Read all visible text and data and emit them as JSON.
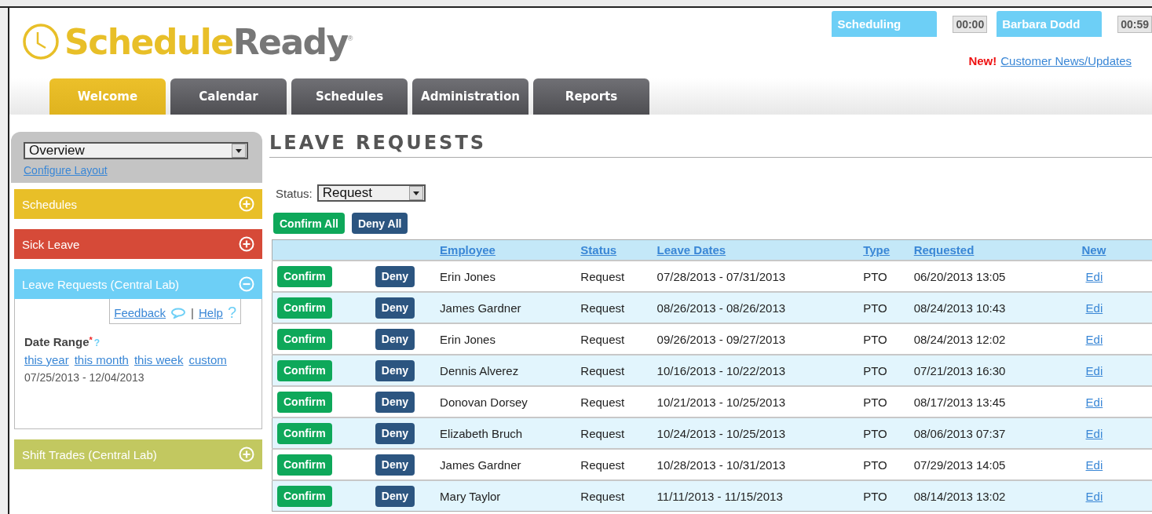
{
  "logo": {
    "word_1": "Schedule",
    "word_2": "Ready",
    "mark": "®"
  },
  "session": [
    {
      "label": "Scheduling",
      "timer": "00:00"
    },
    {
      "label": "Barbara Dodd",
      "timer": "00:59"
    }
  ],
  "news": {
    "badge": "New!",
    "link": "Customer News/Updates"
  },
  "tabs": [
    {
      "label": "Welcome",
      "selected": true
    },
    {
      "label": "Calendar",
      "selected": false
    },
    {
      "label": "Schedules",
      "selected": false
    },
    {
      "label": "Administration",
      "selected": false
    },
    {
      "label": "Reports",
      "selected": false
    }
  ],
  "sidebar": {
    "layout_select": "Overview",
    "configure_link": "Configure Layout",
    "panels": [
      {
        "title": "Schedules",
        "color": "#e8bf28",
        "expanded": false
      },
      {
        "title": "Sick Leave",
        "color": "#d64a38",
        "expanded": false
      },
      {
        "title": "Leave Requests (Central Lab)",
        "color": "#6dcff6",
        "expanded": true,
        "feedback": "Feedback",
        "help": "Help",
        "separator": "|",
        "date_range_label": "Date Range",
        "required_mark": "*",
        "help_mark": "?",
        "range_links": [
          "this year",
          "this month",
          "this week",
          "custom"
        ],
        "range_value": "07/25/2013 - 12/04/2013"
      },
      {
        "title": "Shift Trades (Central Lab)",
        "color": "#c2c860",
        "expanded": false
      }
    ]
  },
  "main": {
    "title": "LEAVE REQUESTS",
    "status_label": "Status:",
    "status_value": "Request",
    "confirm_all": "Confirm All",
    "deny_all": "Deny All",
    "table": {
      "columns": [
        "Employee",
        "Status",
        "Leave Dates",
        "Type",
        "Requested",
        "New"
      ],
      "rows": [
        {
          "confirm": "Confirm",
          "deny": "Deny",
          "employee": "Erin Jones",
          "status": "Request",
          "dates": "07/28/2013 - 07/31/2013",
          "type": "PTO",
          "requested": "06/20/2013 13:05",
          "edit": "Edi"
        },
        {
          "confirm": "Confirm",
          "deny": "Deny",
          "employee": "James Gardner",
          "status": "Request",
          "dates": "08/26/2013 - 08/26/2013",
          "type": "PTO",
          "requested": "08/24/2013 10:43",
          "edit": "Edi"
        },
        {
          "confirm": "Confirm",
          "deny": "Deny",
          "employee": "Erin Jones",
          "status": "Request",
          "dates": "09/26/2013 - 09/27/2013",
          "type": "PTO",
          "requested": "08/24/2013 12:02",
          "edit": "Edi"
        },
        {
          "confirm": "Confirm",
          "deny": "Deny",
          "employee": "Dennis Alverez",
          "status": "Request",
          "dates": "10/16/2013 - 10/22/2013",
          "type": "PTO",
          "requested": "07/21/2013 16:30",
          "edit": "Edi"
        },
        {
          "confirm": "Confirm",
          "deny": "Deny",
          "employee": "Donovan Dorsey",
          "status": "Request",
          "dates": "10/21/2013 - 10/25/2013",
          "type": "PTO",
          "requested": "08/17/2013 13:45",
          "edit": "Edi"
        },
        {
          "confirm": "Confirm",
          "deny": "Deny",
          "employee": "Elizabeth Bruch",
          "status": "Request",
          "dates": "10/24/2013 - 10/25/2013",
          "type": "PTO",
          "requested": "08/06/2013 07:37",
          "edit": "Edi"
        },
        {
          "confirm": "Confirm",
          "deny": "Deny",
          "employee": "James Gardner",
          "status": "Request",
          "dates": "10/28/2013 - 10/31/2013",
          "type": "PTO",
          "requested": "07/29/2013 14:05",
          "edit": "Edi"
        },
        {
          "confirm": "Confirm",
          "deny": "Deny",
          "employee": "Mary Taylor",
          "status": "Request",
          "dates": "11/11/2013 - 11/15/2013",
          "type": "PTO",
          "requested": "08/14/2013 13:02",
          "edit": "Edi"
        }
      ]
    }
  }
}
